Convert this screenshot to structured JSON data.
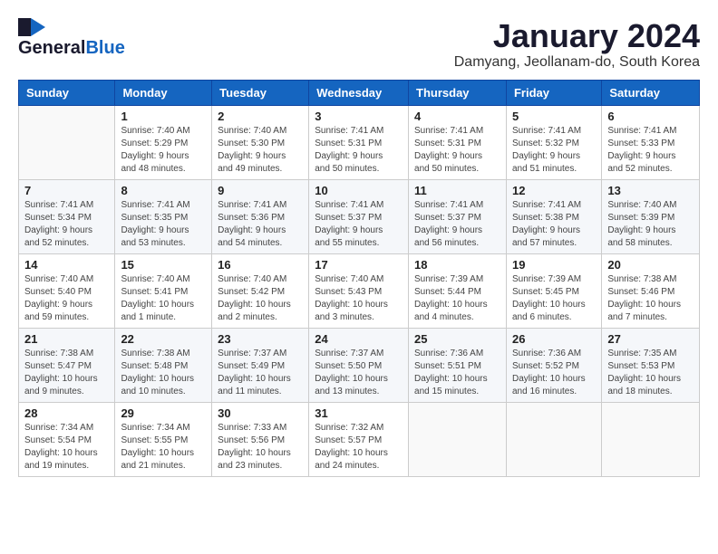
{
  "logo": {
    "general": "General",
    "blue": "Blue"
  },
  "title": "January 2024",
  "location": "Damyang, Jeollanam-do, South Korea",
  "weekdays": [
    "Sunday",
    "Monday",
    "Tuesday",
    "Wednesday",
    "Thursday",
    "Friday",
    "Saturday"
  ],
  "weeks": [
    [
      {
        "day": "",
        "info": ""
      },
      {
        "day": "1",
        "info": "Sunrise: 7:40 AM\nSunset: 5:29 PM\nDaylight: 9 hours\nand 48 minutes."
      },
      {
        "day": "2",
        "info": "Sunrise: 7:40 AM\nSunset: 5:30 PM\nDaylight: 9 hours\nand 49 minutes."
      },
      {
        "day": "3",
        "info": "Sunrise: 7:41 AM\nSunset: 5:31 PM\nDaylight: 9 hours\nand 50 minutes."
      },
      {
        "day": "4",
        "info": "Sunrise: 7:41 AM\nSunset: 5:31 PM\nDaylight: 9 hours\nand 50 minutes."
      },
      {
        "day": "5",
        "info": "Sunrise: 7:41 AM\nSunset: 5:32 PM\nDaylight: 9 hours\nand 51 minutes."
      },
      {
        "day": "6",
        "info": "Sunrise: 7:41 AM\nSunset: 5:33 PM\nDaylight: 9 hours\nand 52 minutes."
      }
    ],
    [
      {
        "day": "7",
        "info": "Sunrise: 7:41 AM\nSunset: 5:34 PM\nDaylight: 9 hours\nand 52 minutes."
      },
      {
        "day": "8",
        "info": "Sunrise: 7:41 AM\nSunset: 5:35 PM\nDaylight: 9 hours\nand 53 minutes."
      },
      {
        "day": "9",
        "info": "Sunrise: 7:41 AM\nSunset: 5:36 PM\nDaylight: 9 hours\nand 54 minutes."
      },
      {
        "day": "10",
        "info": "Sunrise: 7:41 AM\nSunset: 5:37 PM\nDaylight: 9 hours\nand 55 minutes."
      },
      {
        "day": "11",
        "info": "Sunrise: 7:41 AM\nSunset: 5:37 PM\nDaylight: 9 hours\nand 56 minutes."
      },
      {
        "day": "12",
        "info": "Sunrise: 7:41 AM\nSunset: 5:38 PM\nDaylight: 9 hours\nand 57 minutes."
      },
      {
        "day": "13",
        "info": "Sunrise: 7:40 AM\nSunset: 5:39 PM\nDaylight: 9 hours\nand 58 minutes."
      }
    ],
    [
      {
        "day": "14",
        "info": "Sunrise: 7:40 AM\nSunset: 5:40 PM\nDaylight: 9 hours\nand 59 minutes."
      },
      {
        "day": "15",
        "info": "Sunrise: 7:40 AM\nSunset: 5:41 PM\nDaylight: 10 hours\nand 1 minute."
      },
      {
        "day": "16",
        "info": "Sunrise: 7:40 AM\nSunset: 5:42 PM\nDaylight: 10 hours\nand 2 minutes."
      },
      {
        "day": "17",
        "info": "Sunrise: 7:40 AM\nSunset: 5:43 PM\nDaylight: 10 hours\nand 3 minutes."
      },
      {
        "day": "18",
        "info": "Sunrise: 7:39 AM\nSunset: 5:44 PM\nDaylight: 10 hours\nand 4 minutes."
      },
      {
        "day": "19",
        "info": "Sunrise: 7:39 AM\nSunset: 5:45 PM\nDaylight: 10 hours\nand 6 minutes."
      },
      {
        "day": "20",
        "info": "Sunrise: 7:38 AM\nSunset: 5:46 PM\nDaylight: 10 hours\nand 7 minutes."
      }
    ],
    [
      {
        "day": "21",
        "info": "Sunrise: 7:38 AM\nSunset: 5:47 PM\nDaylight: 10 hours\nand 9 minutes."
      },
      {
        "day": "22",
        "info": "Sunrise: 7:38 AM\nSunset: 5:48 PM\nDaylight: 10 hours\nand 10 minutes."
      },
      {
        "day": "23",
        "info": "Sunrise: 7:37 AM\nSunset: 5:49 PM\nDaylight: 10 hours\nand 11 minutes."
      },
      {
        "day": "24",
        "info": "Sunrise: 7:37 AM\nSunset: 5:50 PM\nDaylight: 10 hours\nand 13 minutes."
      },
      {
        "day": "25",
        "info": "Sunrise: 7:36 AM\nSunset: 5:51 PM\nDaylight: 10 hours\nand 15 minutes."
      },
      {
        "day": "26",
        "info": "Sunrise: 7:36 AM\nSunset: 5:52 PM\nDaylight: 10 hours\nand 16 minutes."
      },
      {
        "day": "27",
        "info": "Sunrise: 7:35 AM\nSunset: 5:53 PM\nDaylight: 10 hours\nand 18 minutes."
      }
    ],
    [
      {
        "day": "28",
        "info": "Sunrise: 7:34 AM\nSunset: 5:54 PM\nDaylight: 10 hours\nand 19 minutes."
      },
      {
        "day": "29",
        "info": "Sunrise: 7:34 AM\nSunset: 5:55 PM\nDaylight: 10 hours\nand 21 minutes."
      },
      {
        "day": "30",
        "info": "Sunrise: 7:33 AM\nSunset: 5:56 PM\nDaylight: 10 hours\nand 23 minutes."
      },
      {
        "day": "31",
        "info": "Sunrise: 7:32 AM\nSunset: 5:57 PM\nDaylight: 10 hours\nand 24 minutes."
      },
      {
        "day": "",
        "info": ""
      },
      {
        "day": "",
        "info": ""
      },
      {
        "day": "",
        "info": ""
      }
    ]
  ]
}
